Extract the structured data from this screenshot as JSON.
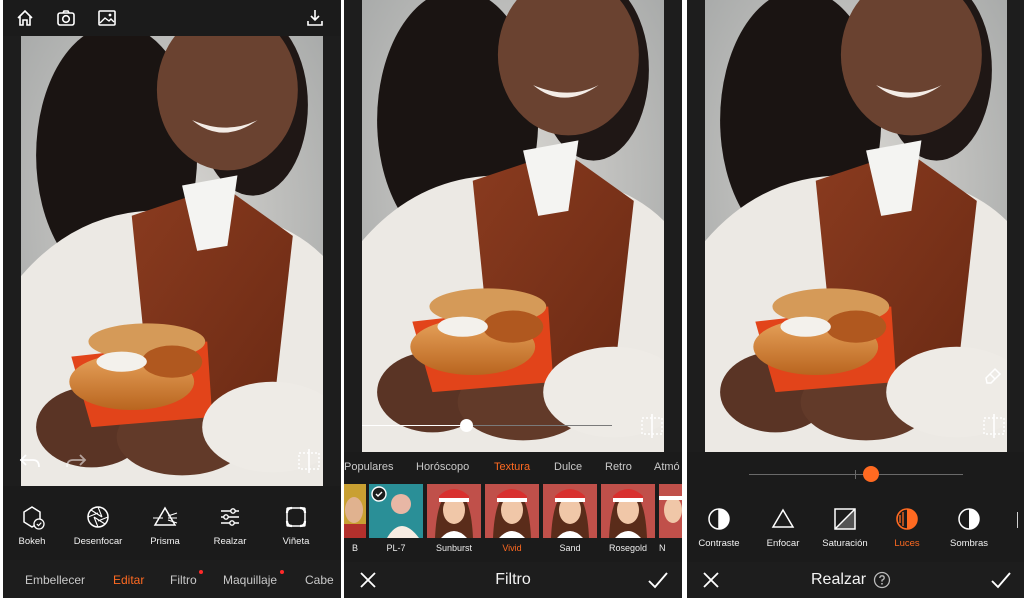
{
  "panel1": {
    "topbar": {
      "icons": [
        "home-icon",
        "camera-icon",
        "gallery-icon",
        "download-icon"
      ]
    },
    "tools": [
      {
        "label": "Bokeh",
        "icon": "bokeh-icon"
      },
      {
        "label": "Desenfocar",
        "icon": "aperture-icon"
      },
      {
        "label": "Prisma",
        "icon": "prism-icon"
      },
      {
        "label": "Realzar",
        "icon": "sliders-icon"
      },
      {
        "label": "Viñeta",
        "icon": "vignette-icon"
      }
    ],
    "tabs": [
      {
        "label": "Embellecer",
        "active": false
      },
      {
        "label": "Editar",
        "active": true
      },
      {
        "label": "Filtro",
        "active": false,
        "badge": true
      },
      {
        "label": "Maquillaje",
        "active": false,
        "badge": true
      },
      {
        "label": "Cabe",
        "active": false
      }
    ]
  },
  "panel2": {
    "slider_value": 0.35,
    "categories": [
      {
        "label": "Populares",
        "active": false
      },
      {
        "label": "Horóscopo",
        "active": false
      },
      {
        "label": "Textura",
        "active": true
      },
      {
        "label": "Dulce",
        "active": false
      },
      {
        "label": "Retro",
        "active": false
      },
      {
        "label": "Atmó",
        "active": false
      }
    ],
    "filters": [
      {
        "label": "B",
        "selected": false
      },
      {
        "label": "PL-7",
        "selected": false
      },
      {
        "label": "Sunburst",
        "selected": false
      },
      {
        "label": "Vivid",
        "selected": true
      },
      {
        "label": "Sand",
        "selected": false
      },
      {
        "label": "Rosegold",
        "selected": false
      },
      {
        "label": "N",
        "selected": false
      }
    ],
    "title": "Filtro"
  },
  "panel3": {
    "slider_value": 0.5,
    "tools": [
      {
        "label": "Contraste",
        "icon": "contrast-icon",
        "active": false
      },
      {
        "label": "Enfocar",
        "icon": "triangle-icon",
        "active": false
      },
      {
        "label": "Saturación",
        "icon": "saturation-icon",
        "active": false
      },
      {
        "label": "Luces",
        "icon": "highlights-icon",
        "active": true
      },
      {
        "label": "Sombras",
        "icon": "shadows-icon",
        "active": false
      }
    ],
    "title": "Realzar"
  },
  "colors": {
    "accent": "#ff6a21",
    "background": "#1d1d1d",
    "badge": "#ff2a2a"
  }
}
